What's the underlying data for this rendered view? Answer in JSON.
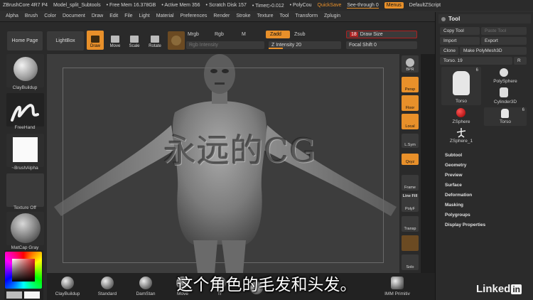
{
  "titlebar": {
    "app": "ZBrushCore 4R7 P4",
    "document": "Model_split_Subtools",
    "free_mem": "• Free Mem 16.378GB",
    "active_mem": "• Active Mem 356",
    "scratch": "• Scratch Disk 157",
    "timer": "• Timer▷0.012",
    "polycount": "• PolyCou",
    "quicksave": "QuickSave",
    "see_through": "See-through  0",
    "menus": "Menus",
    "default_script": "DefaultZScript"
  },
  "menubar": [
    "Alpha",
    "Brush",
    "Color",
    "Document",
    "Draw",
    "Edit",
    "File",
    "Light",
    "Material",
    "Preferences",
    "Render",
    "Stroke",
    "Texture",
    "Tool",
    "Transform",
    "Zplugin"
  ],
  "toolbar": {
    "home": "Home Page",
    "lightbox": "LightBox",
    "draw": "Draw",
    "move": "Move",
    "scale": "Scale",
    "rotate": "Rotate",
    "mrgb": "Mrgb",
    "rgb": "Rgb",
    "m": "M",
    "zadd": "Zadd",
    "zsub": "Zsub",
    "rgb_intensity": "Rgb Intensity",
    "z_intensity": "Z Intensity 20",
    "z_intensity_value": 20,
    "draw_size": "Draw Size",
    "draw_size_value": "18",
    "focal_shift": "Focal Shift 0"
  },
  "left_shelf": {
    "brush": "ClayBuildup",
    "stroke": "FreeHand",
    "alpha": "~BrushAlpha",
    "texture": "Texture Off",
    "material": "MatCap Gray"
  },
  "right_shelf": {
    "bpr": "BPR",
    "persp": "Persp",
    "floor": "Floor",
    "local": "Local",
    "lsym": "L.Sym",
    "qxyz": "Qxyz",
    "frame": "Frame",
    "polyf": "PolyF",
    "transp": "Transp",
    "solo": "Solo",
    "line_fill": "Line Fill"
  },
  "bottom_shelf": [
    "ClayBuildup",
    "Standard",
    "DamStan",
    "Move",
    "Tr",
    "",
    "IMM Primitiv"
  ],
  "palette": {
    "title": "Tool",
    "copy_tool": "Copy Tool",
    "paste_tool": "Paste Tool",
    "import": "Import",
    "export": "Export",
    "clone": "Clone",
    "make_polymesh": "Make PolyMesh3D",
    "r_btn": "R",
    "torso_slider": "Torso. 19",
    "thumbs": [
      {
        "label": "Torso",
        "count": "6"
      },
      {
        "label": "PolySphere",
        "count": ""
      },
      {
        "label": "Cylinder3D",
        "count": ""
      },
      {
        "label": "ZSphere",
        "count": ""
      },
      {
        "label": "Torso",
        "count": "6"
      },
      {
        "label": "ZSphere_1",
        "count": ""
      }
    ],
    "menus": [
      "Subtool",
      "Geometry",
      "Preview",
      "Surface",
      "Deformation",
      "Masking",
      "Polygroups",
      "Display Properties"
    ]
  },
  "overlay": {
    "subtitle": "这个角色的毛发和头发。",
    "watermark": "永远的CG",
    "logo": "Linked"
  },
  "colors": {
    "accent": "#e8902a",
    "panel": "#2b2b2b",
    "viewport": "#3d3d3d"
  }
}
